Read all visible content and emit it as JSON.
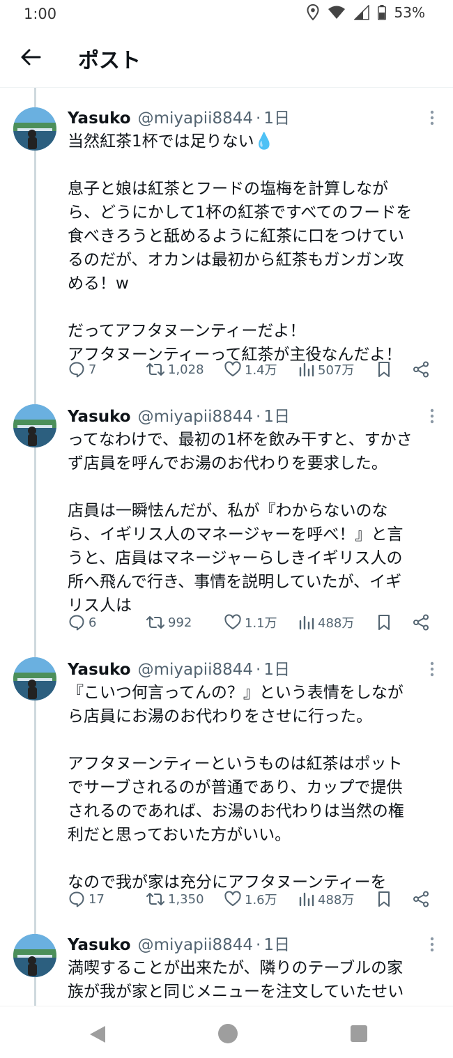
{
  "status_bar": {
    "time": "1:00",
    "battery": "53%",
    "icons": [
      "location-icon",
      "wifi-icon",
      "signal-icon",
      "battery-icon"
    ]
  },
  "header": {
    "title": "ポスト",
    "back_icon": "arrow-left-icon"
  },
  "colors": {
    "text": "#0f1419",
    "secondary": "#536471",
    "thread_line": "#cfd9de"
  },
  "tweets": [
    {
      "name": "Yasuko",
      "handle": "@miyapii8844",
      "sep": "·",
      "time": "1日",
      "text": "当然紅茶1杯では足りない💧\n\n息子と娘は紅茶とフードの塩梅を計算しなが\nら、どうにかして1杯の紅茶ですべてのフードを\n食べきろうと舐めるように紅茶に口をつけてい\nるのだが、オカンは最初から紅茶もガンガン攻\nめる！w\n\nだってアフタヌーンティーだよ！\nアフタヌーンティーって紅茶が主役なんだよ！",
      "replies": "7",
      "reposts": "1,028",
      "likes": "1.4万",
      "views": "507万"
    },
    {
      "name": "Yasuko",
      "handle": "@miyapii8844",
      "sep": "·",
      "time": "1日",
      "text": "ってなわけで、最初の1杯を飲み干すと、すかさ\nず店員を呼んでお湯のお代わりを要求した。\n\n店員は一瞬怯んだが、私が『わからないのな\nら、イギリス人のマネージャーを呼べ！』と言\nうと、店員はマネージャーらしきイギリス人の\n所へ飛んで行き、事情を説明していたが、イギ\nリス人は",
      "replies": "6",
      "reposts": "992",
      "likes": "1.1万",
      "views": "488万"
    },
    {
      "name": "Yasuko",
      "handle": "@miyapii8844",
      "sep": "·",
      "time": "1日",
      "text": "『こいつ何言ってんの？』という表情をしなが\nら店員にお湯のお代わりをさせに行った。\n\nアフタヌーンティーというものは紅茶はポット\nでサーブされるのが普通であり、カップで提供\nされるのであれば、お湯のお代わりは当然の権\n利だと思っておいた方がいい。\n\nなので我が家は充分にアフタヌーンティーを",
      "replies": "17",
      "reposts": "1,350",
      "likes": "1.6万",
      "views": "488万"
    },
    {
      "name": "Yasuko",
      "handle": "@miyapii8844",
      "sep": "·",
      "time": "1日",
      "text": "満喫することが出来たが、隣りのテーブルの家\n族が我が家と同じメニューを注文していたせい\nか、我が家のクレームが気になって仕方なか",
      "replies": "",
      "reposts": "",
      "likes": "",
      "views": ""
    }
  ],
  "nav_bar": {
    "icons": [
      "nav-back-icon",
      "nav-home-icon",
      "nav-recents-icon"
    ]
  }
}
